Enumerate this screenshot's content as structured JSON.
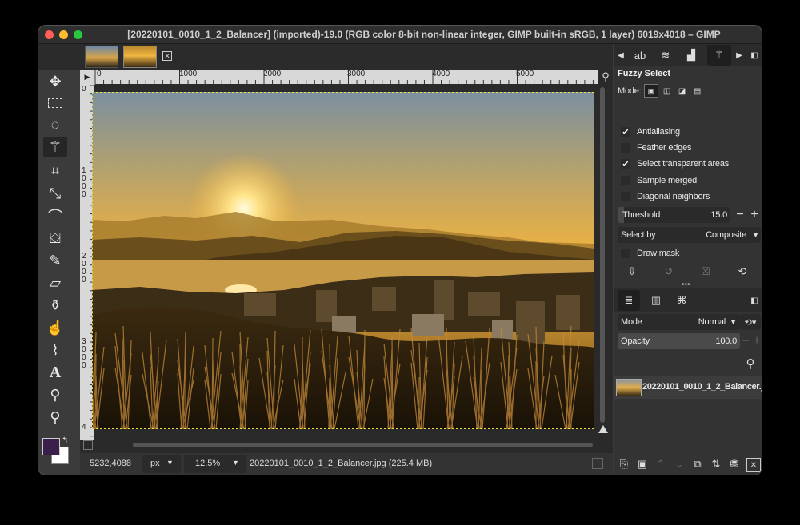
{
  "window": {
    "title": "[20220101_0010_1_2_Balancer] (imported)-19.0 (RGB color 8-bit non-linear integer, GIMP built-in sRGB, 1 layer) 6019x4018 – GIMP",
    "traffic": {
      "close": "#ff5f57",
      "minimize": "#febc2e",
      "zoom": "#28c840"
    }
  },
  "ruler": {
    "h_labels": [
      "0",
      "1000",
      "2000",
      "3000",
      "4000",
      "5000"
    ],
    "v_labels": [
      "0",
      "1\n0\n0\n0",
      "2\n0\n0\n0",
      "3\n0\n0\n0",
      "4"
    ]
  },
  "tools": [
    "move-tool-icon",
    "rect-select-icon",
    "lasso-icon",
    "fuzzy-select-icon",
    "crop-icon",
    "transform-icon",
    "warp-icon",
    "bucket-fill-icon",
    "paintbrush-icon",
    "eraser-icon",
    "clone-icon",
    "smudge-icon",
    "paths-icon",
    "text-icon",
    "color-picker-icon",
    "zoom-icon"
  ],
  "colors": {
    "fg": "#3a1f4a",
    "bg": "#ffffff"
  },
  "status": {
    "coords": "5232,4088",
    "unit": "px",
    "zoom": "12.5%",
    "file_info": "20220101_0010_1_2_Balancer.jpg (225.4 MB)"
  },
  "tool_options": {
    "title": "Fuzzy Select",
    "mode_label": "Mode:",
    "antialiasing": "Antialiasing",
    "feather": "Feather edges",
    "transparent": "Select transparent areas",
    "sample_merged": "Sample merged",
    "diagonal": "Diagonal neighbors",
    "threshold_label": "Threshold",
    "threshold_value": "15.0",
    "threshold_fraction": 0.06,
    "select_by_label": "Select by",
    "select_by_value": "Composite",
    "draw_mask": "Draw mask"
  },
  "layers": {
    "mode_label": "Mode",
    "mode_value": "Normal",
    "opacity_label": "Opacity",
    "opacity_value": "100.0",
    "layer_name": "20220101_0010_1_2_Balancer.jpg"
  }
}
